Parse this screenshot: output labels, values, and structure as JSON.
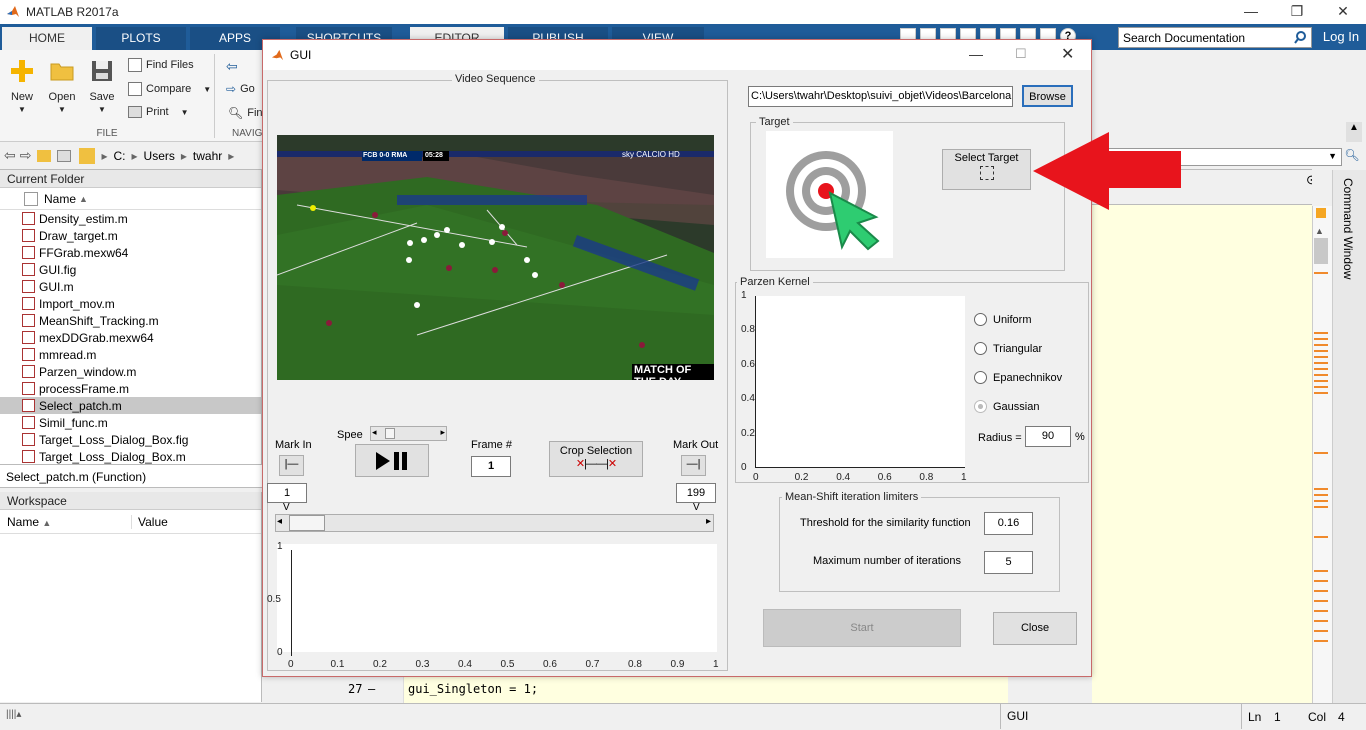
{
  "matlab": {
    "title": "MATLAB R2017a",
    "tabs": [
      "HOME",
      "PLOTS",
      "APPS",
      "SHORTCUTS",
      "EDITOR",
      "PUBLISH",
      "VIEW"
    ],
    "search_placeholder": "Search Documentation",
    "login": "Log In",
    "ribbon": {
      "new": "New",
      "open": "Open",
      "save": "Save",
      "find_files": "Find Files",
      "compare": "Compare",
      "print": "Print",
      "go": "Go",
      "find": "Fin",
      "file_section": "FILE",
      "navigate_section": "NAVIG"
    },
    "address": [
      "C:",
      "Users",
      "twahr"
    ],
    "current_folder_title": "Current Folder",
    "name_col": "Name",
    "files": [
      "Density_estim.m",
      "Draw_target.m",
      "FFGrab.mexw64",
      "GUI.fig",
      "GUI.m",
      "Import_mov.m",
      "MeanShift_Tracking.m",
      "mexDDGrab.mexw64",
      "mmread.m",
      "Parzen_window.m",
      "processFrame.m",
      "Select_patch.m",
      "Simil_func.m",
      "Target_Loss_Dialog_Box.fig",
      "Target_Loss_Dialog_Box.m"
    ],
    "selected_file": "Select_patch.m",
    "details": "Select_patch.m  (Function)",
    "workspace_title": "Workspace",
    "ws_cols": [
      "Name",
      "Value"
    ],
    "command_window": "Command Window",
    "code_line_no": "27",
    "code_line": "gui_Singleton = 1;",
    "status": {
      "gui": "GUI",
      "ln_label": "Ln",
      "ln": "1",
      "col_label": "Col",
      "col": "4"
    }
  },
  "gui": {
    "title": "GUI",
    "video_panel": "Video Sequence",
    "video_overlay": {
      "score": "FCB 0-0 RMA",
      "time": "05:28",
      "channel": "sky CALCIO HD",
      "show": "MATCH OF THE DAY"
    },
    "path": "C:\\Users\\twahr\\Desktop\\suivi_objet\\Videos\\Barcelona",
    "browse": "Browse",
    "target_panel": "Target",
    "select_target": "Select Target",
    "parzen_panel": "Parzen Kernel",
    "kernels": [
      {
        "label": "Uniform",
        "selected": false
      },
      {
        "label": "Triangular",
        "selected": false
      },
      {
        "label": "Epanechnikov",
        "selected": false
      },
      {
        "label": "Gaussian",
        "selected": true
      }
    ],
    "radius_label": "Radius =",
    "radius": "90",
    "radius_unit": "%",
    "kernel_axis_y": [
      "1",
      "0.8",
      "0.6",
      "0.4",
      "0.2",
      "0"
    ],
    "kernel_axis_x": [
      "0",
      "0.2",
      "0.4",
      "0.6",
      "0.8",
      "1"
    ],
    "meanshift_panel": "Mean-Shift iteration limiters",
    "threshold_label": "Threshold for the similarity function",
    "threshold": "0.16",
    "maxiter_label": "Maximum number of iterations",
    "maxiter": "5",
    "start": "Start",
    "close": "Close",
    "mark_in": "Mark In",
    "mark_out": "Mark Out",
    "speed": "Spee",
    "frame_label": "Frame #",
    "frame": "1",
    "crop": "Crop Selection",
    "mark_in_value": "1",
    "mark_out_value": "199",
    "marker_v": "V",
    "plot_y": [
      "1",
      "0.5",
      "0"
    ],
    "plot_x": [
      "0",
      "0.1",
      "0.2",
      "0.3",
      "0.4",
      "0.5",
      "0.6",
      "0.7",
      "0.8",
      "0.9",
      "1"
    ]
  },
  "colors": {
    "matlab_blue": "#1f5c99",
    "annotation_arrow": "#e8141c",
    "target_cursor": "#2ecc71"
  }
}
